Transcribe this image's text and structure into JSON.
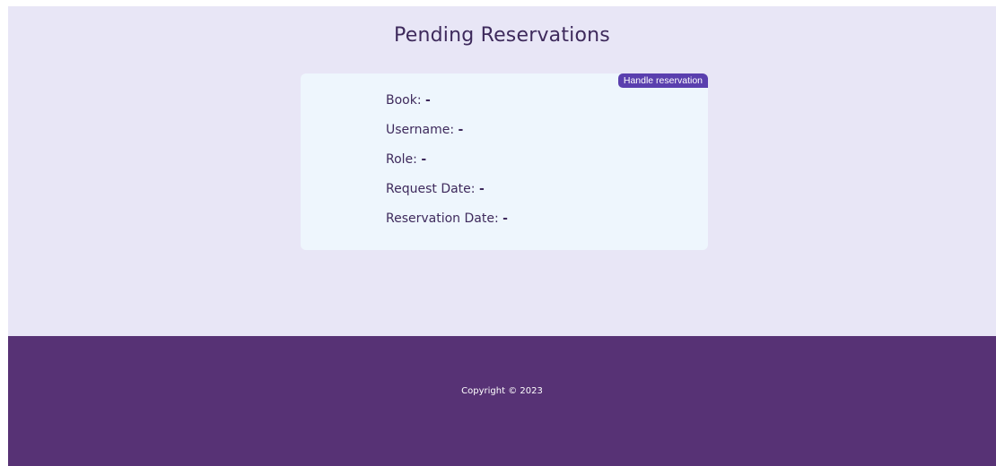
{
  "page": {
    "title": "Pending Reservations"
  },
  "reservation": {
    "action_label": "Handle reservation",
    "fields": [
      {
        "label": "Book:",
        "value": "-"
      },
      {
        "label": "Username:",
        "value": "-"
      },
      {
        "label": "Role:",
        "value": "-"
      },
      {
        "label": "Request Date:",
        "value": "-"
      },
      {
        "label": "Reservation Date:",
        "value": "-"
      }
    ]
  },
  "footer": {
    "copyright": "Copyright © 2023"
  },
  "colors": {
    "background": "#e8e6f6",
    "card": "#eef6fd",
    "accent": "#5a3fae",
    "footer": "#573275",
    "text": "#3e2a5c"
  }
}
